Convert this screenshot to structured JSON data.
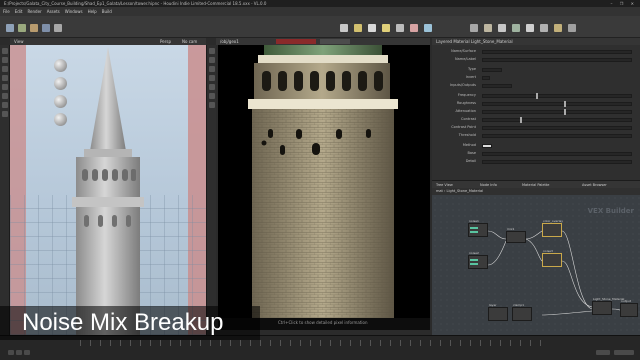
{
  "window": {
    "title": "E:/Projects/Galata_City_Course_Building/Shad_Ep1_Galata/Lesson/tower.hipnc - Houdini Indie Limited-Commercial 18.5.xxx - VL.0.0",
    "controls": "–  ❐  ✕"
  },
  "menu": [
    "File",
    "Edit",
    "Render",
    "Assets",
    "Windows",
    "Help",
    "Build"
  ],
  "viewport_left": {
    "header": "View",
    "persp": "Persp",
    "cam": "No cam"
  },
  "viewport_center": {
    "header": "/obj/geo1",
    "hint": "Ctrl+Click to show detailed pixel information"
  },
  "params": {
    "header": "Layered Material   Light_Stone_Material",
    "rows": [
      "Name/Surface",
      "Name/Label",
      "Type",
      "Invert",
      "Inputs/Outputs",
      "Frequency",
      "Roughness",
      "Attenuation",
      "Contrast",
      "Contrast Point",
      "Threshold",
      "Method",
      "Base",
      "Detail"
    ]
  },
  "network": {
    "tabs": [
      "Tree View",
      "Node Info",
      "Material Palette",
      "Asset Browser"
    ],
    "path": "mat › Light_Stone_Material",
    "watermark": "VEX Builder",
    "nodes": [
      {
        "label": "noise1"
      },
      {
        "label": "noise2"
      },
      {
        "label": "mix1"
      },
      {
        "label": "color_overlay"
      },
      {
        "label": "noise3"
      },
      {
        "label": "layer"
      },
      {
        "label": "clamp1"
      },
      {
        "label": "Light_Stone_Material"
      },
      {
        "label": "output"
      }
    ]
  },
  "caption": "Noise Mix Breakup",
  "colors": {
    "accent": "#6fcfa0",
    "caption_bg": "#000000",
    "caption_text": "#ffffff"
  }
}
